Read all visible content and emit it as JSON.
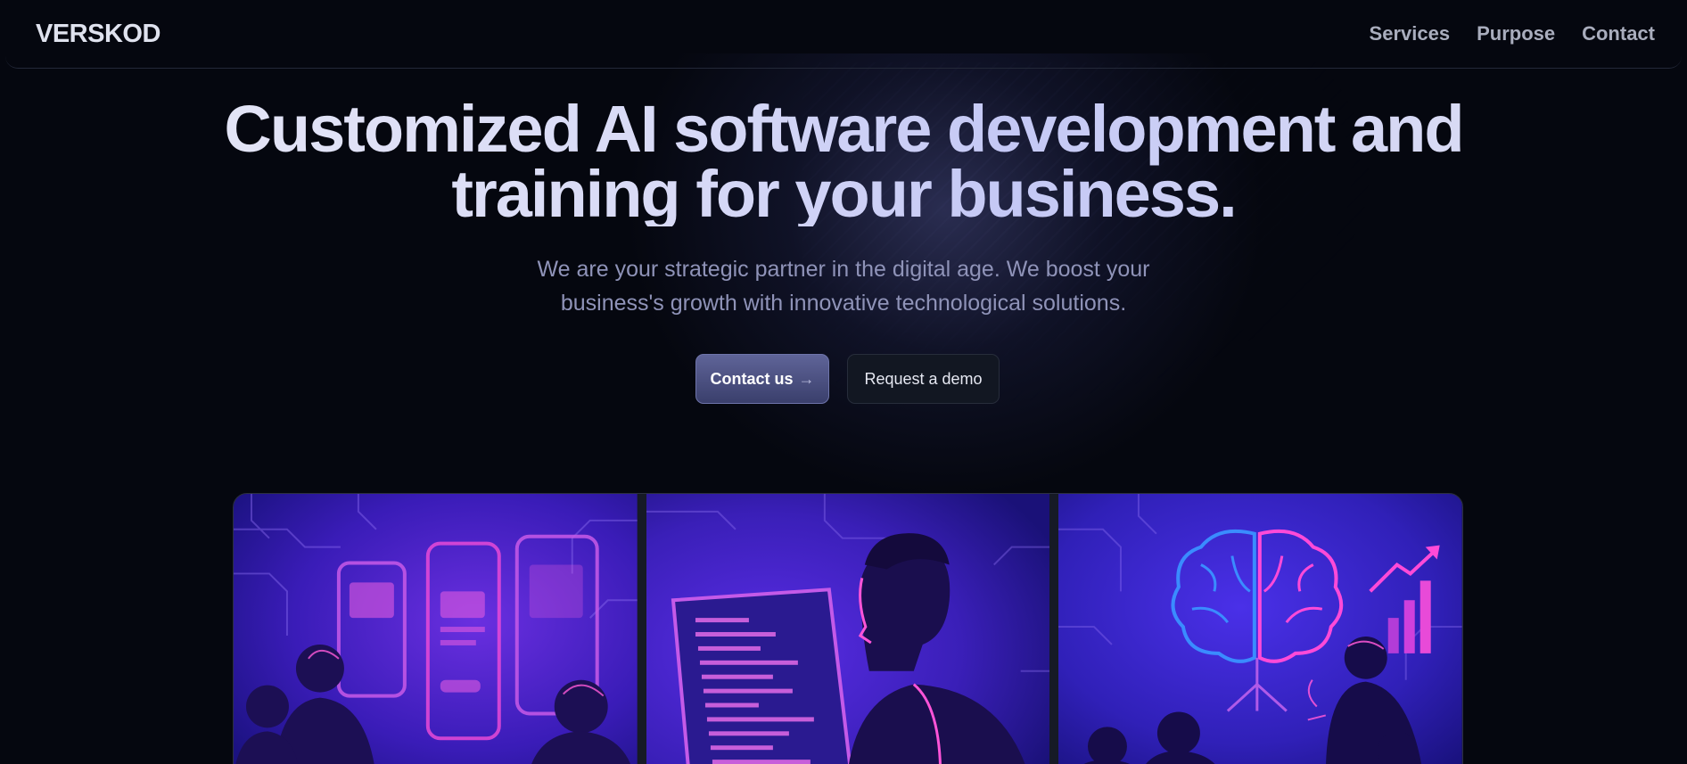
{
  "header": {
    "logo": "VERSKOD",
    "nav": [
      "Services",
      "Purpose",
      "Contact"
    ]
  },
  "hero": {
    "title_line1": "Customized AI software development and",
    "title_line2": "training for your business.",
    "subtitle_line1": "We are your strategic partner in the digital age. We boost your",
    "subtitle_line2": "business's growth with innovative technological solutions.",
    "primary_button": "Contact us",
    "primary_arrow": "→",
    "secondary_button": "Request a demo"
  },
  "gallery": {
    "panels": [
      "app-design-team-illustration",
      "developer-coding-illustration",
      "ai-brain-growth-illustration"
    ]
  },
  "colors": {
    "background": "#05070f",
    "accent": "#5f6498",
    "panel_purple": "#3b1fc4",
    "panel_magenta": "#e33cd4"
  }
}
